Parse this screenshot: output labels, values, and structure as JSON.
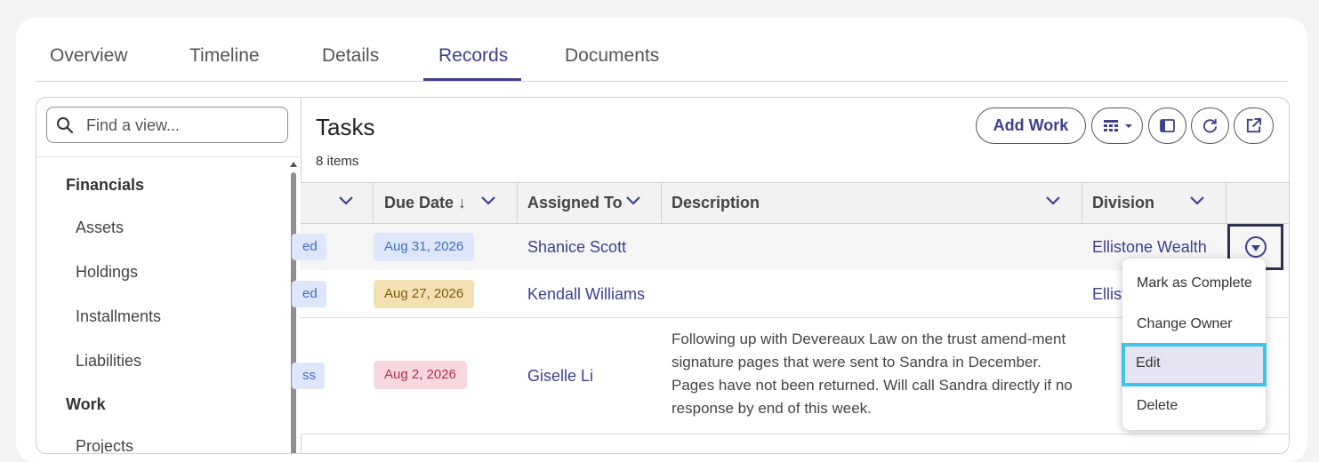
{
  "tabs": [
    {
      "label": "Overview"
    },
    {
      "label": "Timeline"
    },
    {
      "label": "Details"
    },
    {
      "label": "Records",
      "active": true
    },
    {
      "label": "Documents"
    }
  ],
  "sidebar": {
    "search_placeholder": "Find a view...",
    "groups": [
      {
        "label": "Financials",
        "items": [
          "Assets",
          "Holdings",
          "Installments",
          "Liabilities"
        ]
      },
      {
        "label": "Work",
        "items": [
          "Projects"
        ]
      }
    ]
  },
  "main": {
    "title": "Tasks",
    "item_count": "8 items",
    "add_work_label": "Add Work",
    "toolbar_icons": [
      "grid-view-icon",
      "panel-toggle-icon",
      "refresh-icon",
      "open-external-icon"
    ]
  },
  "grid": {
    "columns": [
      "Due Date ↓",
      "Assigned To",
      "Description",
      "Division"
    ],
    "rows": [
      {
        "status": "ed",
        "due": "Aug 31, 2026",
        "due_color": "#dde6fb",
        "due_text": "#3f6fc0",
        "assignee": "Shanice Scott",
        "description": "",
        "division": "Ellistone Wealth"
      },
      {
        "status": "ed",
        "due": "Aug 27, 2026",
        "due_color": "#f4e1b3",
        "due_text": "#7a5a10",
        "assignee": "Kendall Williams",
        "description": "",
        "division": "Ellist"
      },
      {
        "status": "ss",
        "due": "Aug 2, 2026",
        "due_color": "#f8d8e0",
        "due_text": "#b0304f",
        "assignee": "Giselle Li",
        "description": "Following up with Devereaux Law on the trust amend-ment signature pages that were sent to Sandra in December. Pages have not been returned. Will call Sandra directly if no response by end of this week.",
        "division": ""
      }
    ]
  },
  "menu": {
    "items": [
      "Mark as Complete",
      "Change Owner",
      "Edit",
      "Delete"
    ],
    "focused": "Edit"
  },
  "colors": {
    "accent": "#3f3f8f",
    "focus_ring": "#3cc4ea",
    "menu_focus_bg": "#e6e4f3"
  }
}
